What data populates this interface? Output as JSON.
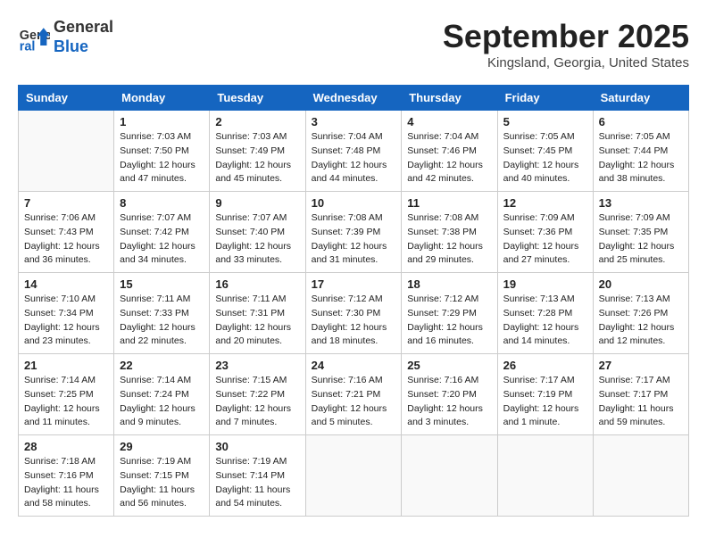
{
  "header": {
    "logo_line1": "General",
    "logo_line2": "Blue",
    "month": "September 2025",
    "location": "Kingsland, Georgia, United States"
  },
  "days_of_week": [
    "Sunday",
    "Monday",
    "Tuesday",
    "Wednesday",
    "Thursday",
    "Friday",
    "Saturday"
  ],
  "weeks": [
    [
      {
        "day": "",
        "info": ""
      },
      {
        "day": "1",
        "info": "Sunrise: 7:03 AM\nSunset: 7:50 PM\nDaylight: 12 hours\nand 47 minutes."
      },
      {
        "day": "2",
        "info": "Sunrise: 7:03 AM\nSunset: 7:49 PM\nDaylight: 12 hours\nand 45 minutes."
      },
      {
        "day": "3",
        "info": "Sunrise: 7:04 AM\nSunset: 7:48 PM\nDaylight: 12 hours\nand 44 minutes."
      },
      {
        "day": "4",
        "info": "Sunrise: 7:04 AM\nSunset: 7:46 PM\nDaylight: 12 hours\nand 42 minutes."
      },
      {
        "day": "5",
        "info": "Sunrise: 7:05 AM\nSunset: 7:45 PM\nDaylight: 12 hours\nand 40 minutes."
      },
      {
        "day": "6",
        "info": "Sunrise: 7:05 AM\nSunset: 7:44 PM\nDaylight: 12 hours\nand 38 minutes."
      }
    ],
    [
      {
        "day": "7",
        "info": "Sunrise: 7:06 AM\nSunset: 7:43 PM\nDaylight: 12 hours\nand 36 minutes."
      },
      {
        "day": "8",
        "info": "Sunrise: 7:07 AM\nSunset: 7:42 PM\nDaylight: 12 hours\nand 34 minutes."
      },
      {
        "day": "9",
        "info": "Sunrise: 7:07 AM\nSunset: 7:40 PM\nDaylight: 12 hours\nand 33 minutes."
      },
      {
        "day": "10",
        "info": "Sunrise: 7:08 AM\nSunset: 7:39 PM\nDaylight: 12 hours\nand 31 minutes."
      },
      {
        "day": "11",
        "info": "Sunrise: 7:08 AM\nSunset: 7:38 PM\nDaylight: 12 hours\nand 29 minutes."
      },
      {
        "day": "12",
        "info": "Sunrise: 7:09 AM\nSunset: 7:36 PM\nDaylight: 12 hours\nand 27 minutes."
      },
      {
        "day": "13",
        "info": "Sunrise: 7:09 AM\nSunset: 7:35 PM\nDaylight: 12 hours\nand 25 minutes."
      }
    ],
    [
      {
        "day": "14",
        "info": "Sunrise: 7:10 AM\nSunset: 7:34 PM\nDaylight: 12 hours\nand 23 minutes."
      },
      {
        "day": "15",
        "info": "Sunrise: 7:11 AM\nSunset: 7:33 PM\nDaylight: 12 hours\nand 22 minutes."
      },
      {
        "day": "16",
        "info": "Sunrise: 7:11 AM\nSunset: 7:31 PM\nDaylight: 12 hours\nand 20 minutes."
      },
      {
        "day": "17",
        "info": "Sunrise: 7:12 AM\nSunset: 7:30 PM\nDaylight: 12 hours\nand 18 minutes."
      },
      {
        "day": "18",
        "info": "Sunrise: 7:12 AM\nSunset: 7:29 PM\nDaylight: 12 hours\nand 16 minutes."
      },
      {
        "day": "19",
        "info": "Sunrise: 7:13 AM\nSunset: 7:28 PM\nDaylight: 12 hours\nand 14 minutes."
      },
      {
        "day": "20",
        "info": "Sunrise: 7:13 AM\nSunset: 7:26 PM\nDaylight: 12 hours\nand 12 minutes."
      }
    ],
    [
      {
        "day": "21",
        "info": "Sunrise: 7:14 AM\nSunset: 7:25 PM\nDaylight: 12 hours\nand 11 minutes."
      },
      {
        "day": "22",
        "info": "Sunrise: 7:14 AM\nSunset: 7:24 PM\nDaylight: 12 hours\nand 9 minutes."
      },
      {
        "day": "23",
        "info": "Sunrise: 7:15 AM\nSunset: 7:22 PM\nDaylight: 12 hours\nand 7 minutes."
      },
      {
        "day": "24",
        "info": "Sunrise: 7:16 AM\nSunset: 7:21 PM\nDaylight: 12 hours\nand 5 minutes."
      },
      {
        "day": "25",
        "info": "Sunrise: 7:16 AM\nSunset: 7:20 PM\nDaylight: 12 hours\nand 3 minutes."
      },
      {
        "day": "26",
        "info": "Sunrise: 7:17 AM\nSunset: 7:19 PM\nDaylight: 12 hours\nand 1 minute."
      },
      {
        "day": "27",
        "info": "Sunrise: 7:17 AM\nSunset: 7:17 PM\nDaylight: 11 hours\nand 59 minutes."
      }
    ],
    [
      {
        "day": "28",
        "info": "Sunrise: 7:18 AM\nSunset: 7:16 PM\nDaylight: 11 hours\nand 58 minutes."
      },
      {
        "day": "29",
        "info": "Sunrise: 7:19 AM\nSunset: 7:15 PM\nDaylight: 11 hours\nand 56 minutes."
      },
      {
        "day": "30",
        "info": "Sunrise: 7:19 AM\nSunset: 7:14 PM\nDaylight: 11 hours\nand 54 minutes."
      },
      {
        "day": "",
        "info": ""
      },
      {
        "day": "",
        "info": ""
      },
      {
        "day": "",
        "info": ""
      },
      {
        "day": "",
        "info": ""
      }
    ]
  ]
}
